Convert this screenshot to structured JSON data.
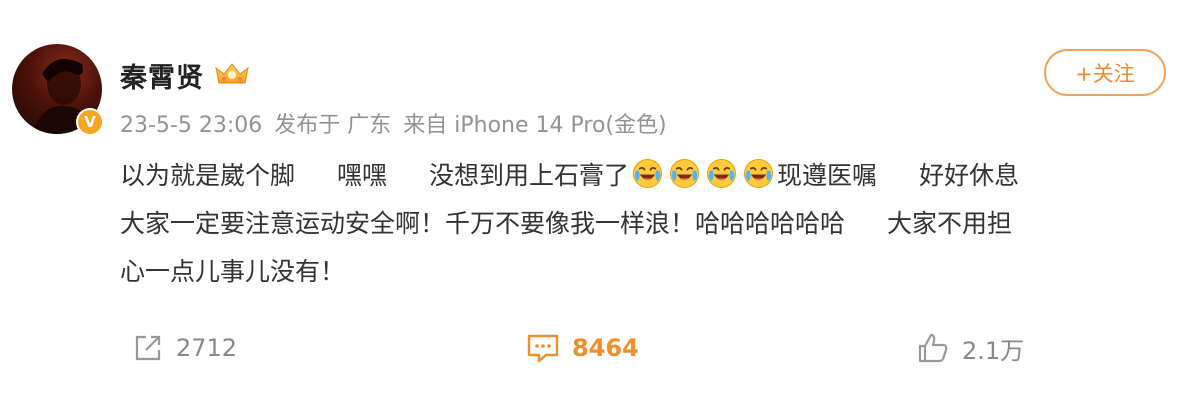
{
  "post": {
    "author": {
      "name": "秦霄贤",
      "verified_badge": "V",
      "member_icon": "vip-crown-icon"
    },
    "meta": {
      "datetime": "23-5-5 23:06",
      "location": "发布于 广东",
      "source": "来自 iPhone 14 Pro(金色)"
    },
    "follow_label": "+关注",
    "content": {
      "line1": {
        "part1": "以为就是崴个脚",
        "part2": "嘿嘿",
        "part3": "没想到用上石膏了",
        "emoji": "laugh-cry-emoji",
        "emoji_count": 4,
        "part4": "现遵医嘱",
        "part5": "好好休息"
      },
      "line2": {
        "part1": "大家一定要注意运动安全啊！千万不要像我一样浪！哈哈哈哈哈哈",
        "part2": "大家不用担"
      },
      "line3": "心一点儿事儿没有！"
    },
    "actions": {
      "repost": {
        "icon": "share-icon",
        "count": "2712"
      },
      "comment": {
        "icon": "comment-icon",
        "count": "8464"
      },
      "like": {
        "icon": "thumbs-up-icon",
        "count": "2.1万"
      }
    },
    "colors": {
      "accent": "#f08f2a",
      "meta_text": "#939393",
      "body_text": "#333333"
    }
  }
}
